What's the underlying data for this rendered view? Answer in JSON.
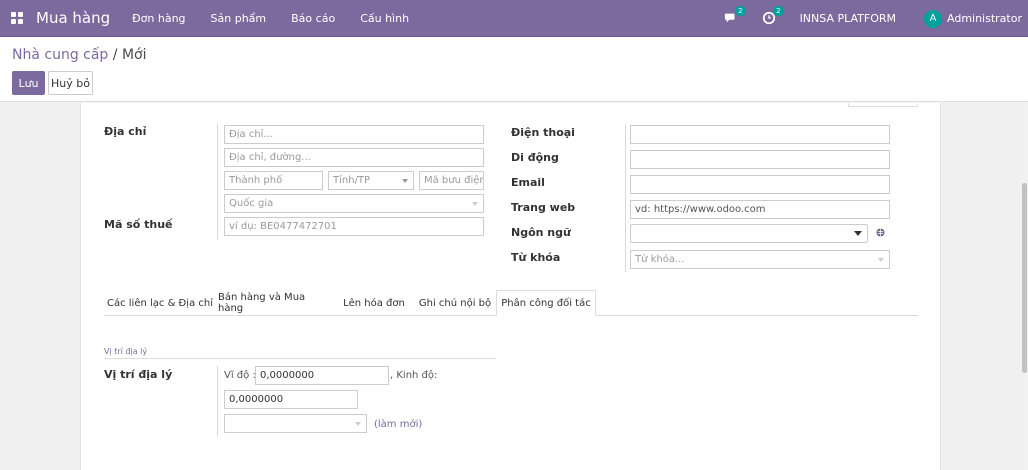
{
  "navbar": {
    "app_name": "Mua hàng",
    "menu": [
      "Đơn hàng",
      "Sản phẩm",
      "Báo cáo",
      "Cấu hình"
    ],
    "messages_badge": "2",
    "activities_badge": "2",
    "company": "INNSA PLATFORM",
    "user_initial": "A",
    "user_name": "Administrator"
  },
  "breadcrumb": {
    "parent": "Nhà cung cấp",
    "separator": " / ",
    "current": "Mới"
  },
  "buttons": {
    "save": "Lưu",
    "discard": "Huỷ bỏ"
  },
  "address": {
    "label": "Địa chỉ",
    "street_placeholder": "Địa chỉ...",
    "street2_placeholder": "Địa chỉ, đường...",
    "city_placeholder": "Thành phố",
    "state_placeholder": "Tỉnh/TP",
    "zip_placeholder": "Mã bưu điện",
    "country_placeholder": "Quốc gia"
  },
  "vat": {
    "label": "Mã số thuế",
    "placeholder": "ví dụ: BE0477472701"
  },
  "right_fields": {
    "phone_label": "Điện thoại",
    "mobile_label": "Di động",
    "email_label": "Email",
    "website_label": "Trang web",
    "website_placeholder": "vd: https://www.odoo.com",
    "language_label": "Ngôn ngữ",
    "tags_label": "Từ khóa",
    "tags_placeholder": "Từ khóa..."
  },
  "tabs": [
    "Các liên lạc & Địa chỉ",
    "Bán hàng và Mua hàng",
    "Lên hóa đơn",
    "Ghi chú nội bộ",
    "Phân công đối tác"
  ],
  "geo": {
    "group_title": "Vị trí địa lý",
    "label": "Vị trí địa lý",
    "lat_label": "Vĩ độ :",
    "lat_value": "0,0000000",
    "long_label": ", Kinh độ:",
    "long_value": "0,0000000",
    "refresh_label": "(làm mới)"
  }
}
